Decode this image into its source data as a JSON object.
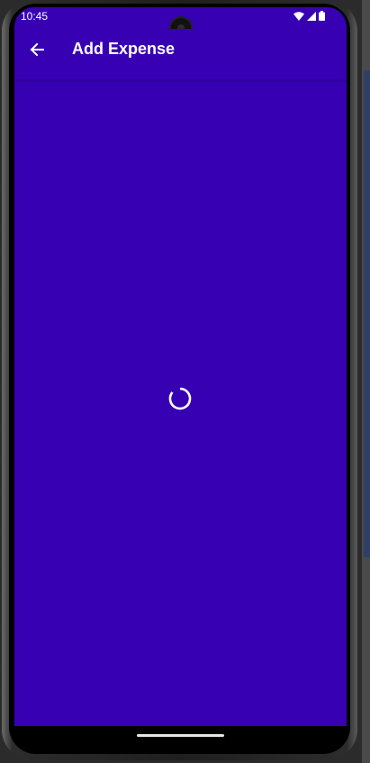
{
  "status_bar": {
    "time": "10:45",
    "icons": [
      "wifi-icon",
      "cell-signal-icon",
      "battery-icon"
    ]
  },
  "app_bar": {
    "title": "Add Expense",
    "back_icon": "arrow-back-icon"
  },
  "content": {
    "loading_indicator": "progress-spinner-icon"
  },
  "colors": {
    "primary": "#3700b3",
    "on_primary": "#ffffff",
    "nav_bar": "#000000"
  }
}
